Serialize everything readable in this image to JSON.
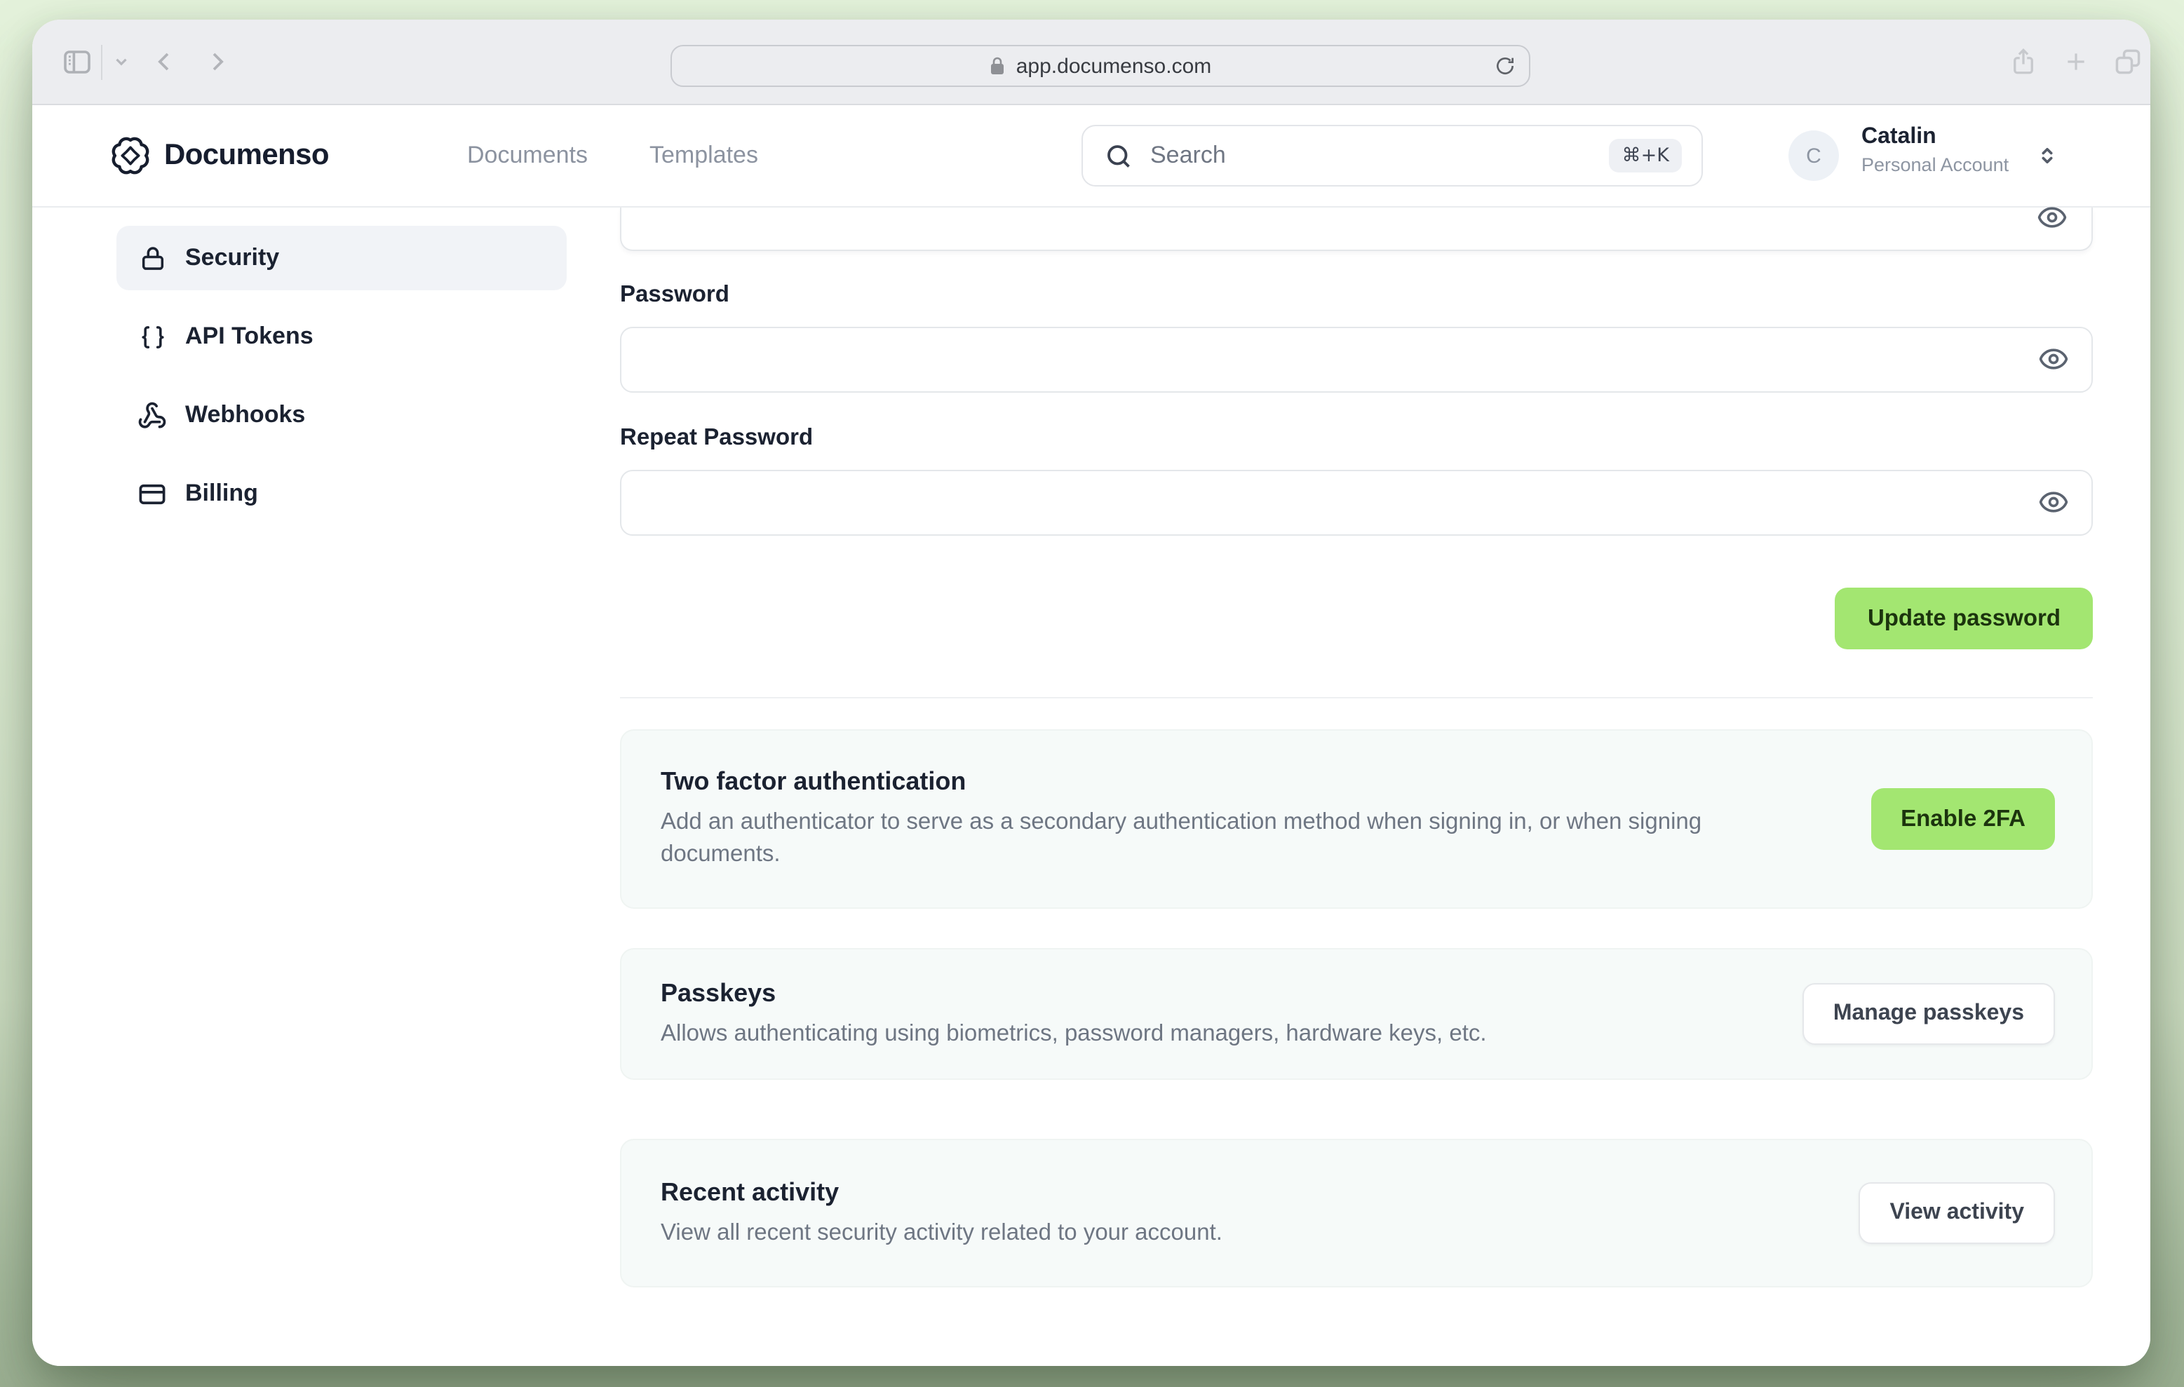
{
  "browser": {
    "url": "app.documenso.com",
    "icons": {
      "left": [
        "sidebar-toggle-icon",
        "chevron-down-icon",
        "back-icon",
        "forward-icon"
      ],
      "urlbar": [
        "lock-icon",
        "refresh-icon"
      ],
      "right": [
        "share-icon",
        "new-tab-icon",
        "tab-overview-icon"
      ]
    }
  },
  "header": {
    "brand": "Documenso",
    "logo_icon": "documenso-logo-icon",
    "nav": [
      {
        "label": "Documents"
      },
      {
        "label": "Templates"
      }
    ],
    "search": {
      "icon": "search-icon",
      "placeholder": "Search",
      "shortcut": "⌘+K"
    },
    "account": {
      "initial": "C",
      "name": "Catalin",
      "type": "Personal Account",
      "switcher_icon": "chevrons-up-down-icon"
    }
  },
  "sidebar": {
    "items": [
      {
        "label": "Security",
        "icon": "lock-icon",
        "active": true
      },
      {
        "label": "API Tokens",
        "icon": "braces-icon",
        "active": false
      },
      {
        "label": "Webhooks",
        "icon": "webhook-icon",
        "active": false
      },
      {
        "label": "Billing",
        "icon": "credit-card-icon",
        "active": false
      }
    ]
  },
  "main": {
    "password_form": {
      "password_label": "Password",
      "repeat_password_label": "Repeat Password",
      "password_value": "",
      "repeat_password_value": "",
      "submit_label": "Update password",
      "reveal_icon": "eye-icon"
    },
    "sections": [
      {
        "title": "Two factor authentication",
        "description": "Add an authenticator to serve as a secondary authentication method when signing in, or when signing documents.",
        "button": "Enable 2FA",
        "button_style": "primary"
      },
      {
        "title": "Passkeys",
        "description": "Allows authenticating using biometrics, password managers, hardware keys, etc.",
        "button": "Manage passkeys",
        "button_style": "outline"
      },
      {
        "title": "Recent activity",
        "description": "View all recent security activity related to your account.",
        "button": "View activity",
        "button_style": "outline"
      }
    ]
  },
  "colors": {
    "accent_green": "#a3e671",
    "accent_green_text": "#1c340e",
    "background_top": "#e4f2db",
    "background_bottom": "#9cb093",
    "toolbar_bg": "#ecedf0",
    "active_item_bg": "#f1f3f7",
    "card_bg": "#f6faf9",
    "text_dark": "#1b2231",
    "text_muted": "#6e7683"
  }
}
